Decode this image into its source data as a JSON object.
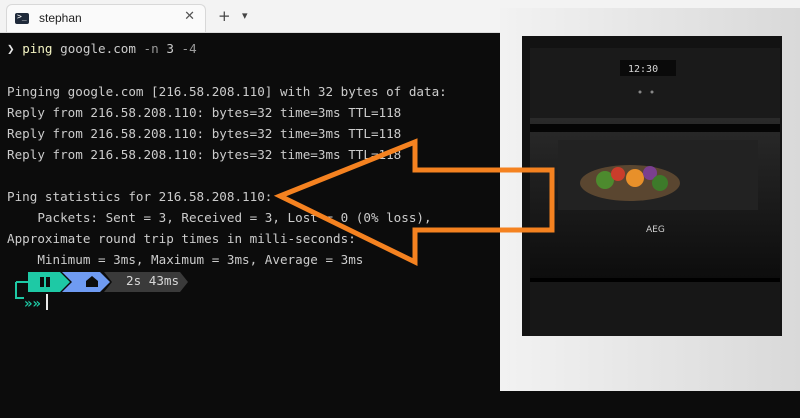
{
  "tab": {
    "title": "stephan",
    "close": "✕",
    "new": "+",
    "menu": "⌄"
  },
  "terminal": {
    "prompt_chevron": "❯",
    "command_name": "ping",
    "command_host": "google.com",
    "command_flag_n": "-n",
    "command_n_value": "3",
    "command_flag_4": "-4",
    "lines": [
      "Pinging google.com [216.58.208.110] with 32 bytes of data:",
      "Reply from 216.58.208.110: bytes=32 time=3ms TTL=118",
      "Reply from 216.58.208.110: bytes=32 time=3ms TTL=118",
      "Reply from 216.58.208.110: bytes=32 time=3ms TTL=118",
      "Ping statistics for 216.58.208.110:",
      "    Packets: Sent = 3, Received = 3, Lost = 0 (0% loss),",
      "Approximate round trip times in milli-seconds:",
      "    Minimum = 3ms, Maximum = 3ms, Average = 3ms"
    ],
    "status_duration": "2s 43ms",
    "prompt_arrows": "»"
  },
  "overlay": {
    "arrow_color": "#f58220",
    "oven_brand": "AEG",
    "oven_clock": "12:30"
  },
  "colors": {
    "segment_teal": "#1ec9a5",
    "segment_blue": "#6f9bf2",
    "segment_gray": "#3a3a3a"
  }
}
